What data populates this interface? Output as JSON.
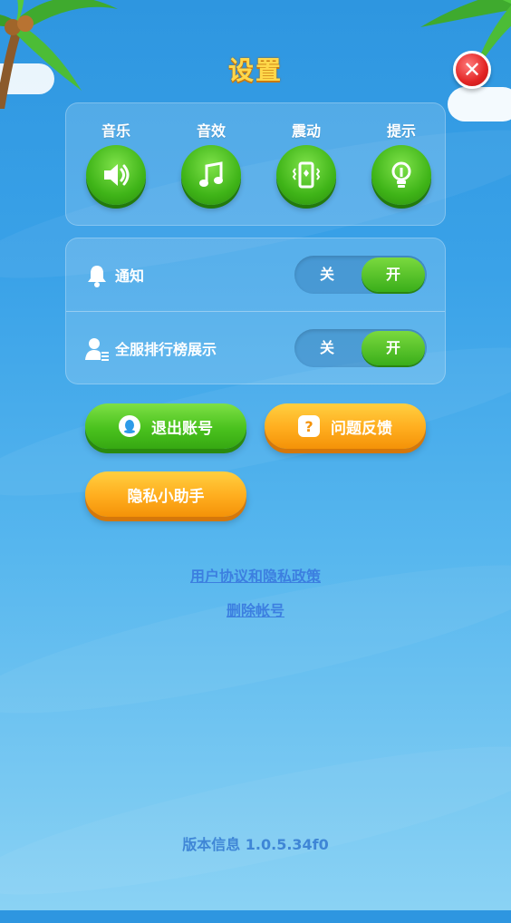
{
  "header": {
    "title": "设置"
  },
  "audio_controls": [
    {
      "label": "音乐",
      "icon": "speaker-icon"
    },
    {
      "label": "音效",
      "icon": "music-note-icon"
    },
    {
      "label": "震动",
      "icon": "vibration-phone-icon"
    },
    {
      "label": "提示",
      "icon": "lightbulb-icon"
    }
  ],
  "toggles": [
    {
      "label": "通知",
      "off_label": "关",
      "on_label": "开",
      "state": "on",
      "icon": "bell-icon"
    },
    {
      "label": "全服排行榜展示",
      "off_label": "关",
      "on_label": "开",
      "state": "on",
      "icon": "user-ranking-icon"
    }
  ],
  "buttons": {
    "logout": "退出账号",
    "feedback": "问题反馈",
    "privacy_assistant": "隐私小助手"
  },
  "links": {
    "agreement": "用户协议和隐私政策",
    "delete_account": "删除帐号"
  },
  "footer": {
    "version": "版本信息 1.0.5.34f0"
  },
  "colors": {
    "title": "#ffd84a",
    "green_button": "#4ac21e",
    "orange_button": "#ffad1e",
    "close_button": "#e22424",
    "link": "#3c7fe0"
  }
}
